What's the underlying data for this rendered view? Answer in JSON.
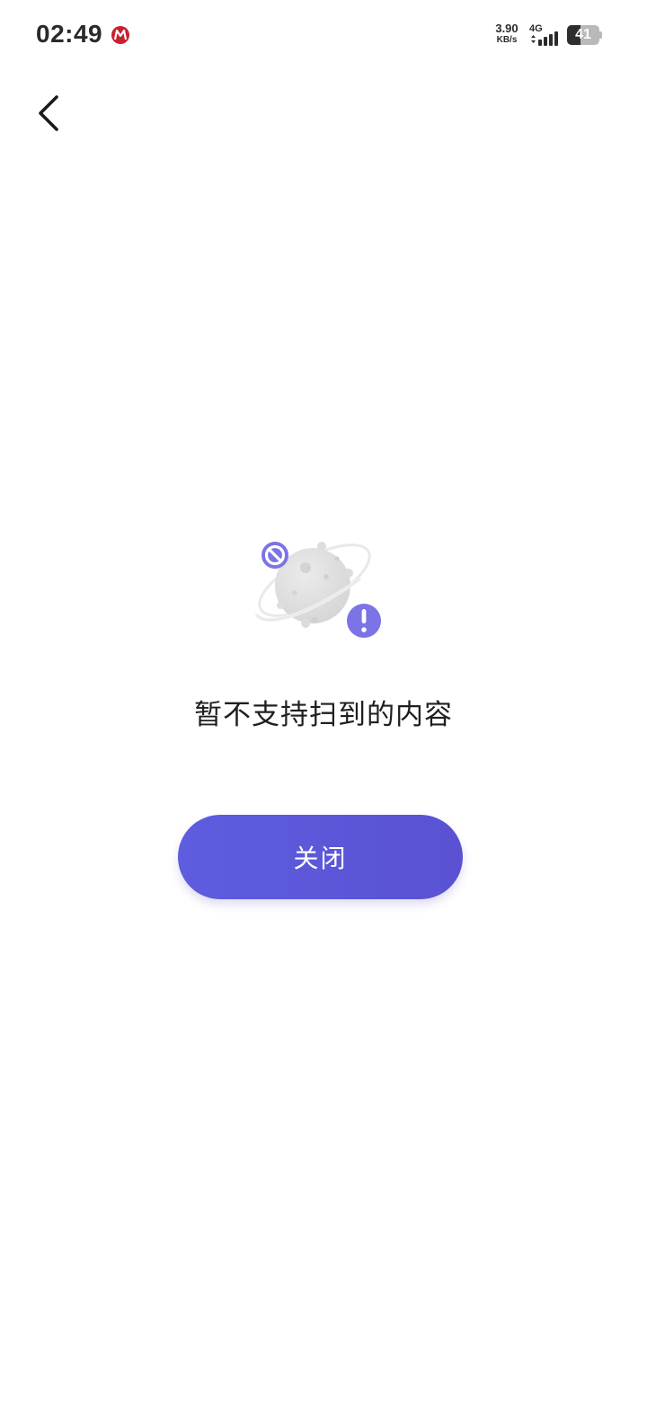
{
  "status_bar": {
    "time": "02:49",
    "app_icon": "metro-logo-icon",
    "net_speed_value": "3.90",
    "net_speed_unit": "KB/s",
    "network_type": "4G",
    "signal_icon": "cell-signal-icon",
    "battery_level": "41",
    "battery_fraction": 0.41
  },
  "nav": {
    "back_icon": "chevron-left-icon"
  },
  "content": {
    "illustration_icon": "unsupported-planet-icon",
    "message": "暂不支持扫到的内容",
    "close_label": "关闭"
  },
  "colors": {
    "accent": "#5b57d9",
    "illustration_badge": "#7b73e6",
    "planet": "#e4e4e4"
  }
}
